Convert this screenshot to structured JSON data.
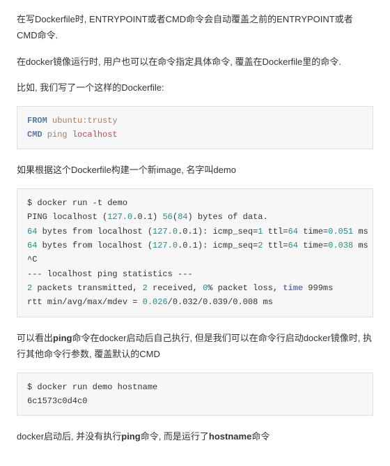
{
  "para1": "在写Dockerfile时, ENTRYPOINT或者CMD命令会自动覆盖之前的ENTRYPOINT或者CMD命令.",
  "para2": "在docker镜像运行时, 用户也可以在命令指定具体命令, 覆盖在Dockerfile里的命令.",
  "para3": "比如, 我们写了一个这样的Dockerfile:",
  "code1": {
    "from_kw": "FROM",
    "from_val": " ubuntu:trusty",
    "cmd_kw": "CMD",
    "cmd_cmd": " ping",
    "cmd_arg": " localhost"
  },
  "para4": "如果根据这个Dockerfile构建一个新image, 名字叫demo",
  "code2": {
    "line1_a": "$ docker run -t demo",
    "line2_a": "PING localhost (",
    "line2_ip": "127.0",
    "line2_b": ".0.1) ",
    "line2_n1": "56",
    "line2_c": "(",
    "line2_n2": "84",
    "line2_d": ") bytes of data.",
    "line3_n1": "64",
    "line3_a": " bytes from localhost (",
    "line3_ip": "127.0",
    "line3_b": ".0.1): icmp_seq=",
    "line3_n2": "1",
    "line3_c": " ttl=",
    "line3_n3": "64",
    "line3_d": " time=",
    "line3_n4": "0.051",
    "line3_e": " ms",
    "line4_n1": "64",
    "line4_a": " bytes from localhost (",
    "line4_ip": "127.0",
    "line4_b": ".0.1): icmp_seq=",
    "line4_n2": "2",
    "line4_c": " ttl=",
    "line4_n3": "64",
    "line4_d": " time=",
    "line4_n4": "0.038",
    "line4_e": " ms",
    "line5": "^C",
    "line6": "--- localhost ping statistics ---",
    "line7_n1": "2",
    "line7_a": " packets transmitted, ",
    "line7_n2": "2",
    "line7_b": " received, ",
    "line7_n3": "0",
    "line7_c": "% packet loss, ",
    "line7_tk": "time",
    "line7_d": " 999ms",
    "line8_a": "rtt min/avg/max/mdev = ",
    "line8_n": "0.026",
    "line8_b": "/0.032/0.039/0.008 ms"
  },
  "para5_a": "可以看出",
  "para5_b": "ping",
  "para5_c": "命令在docker启动后自己执行, 但是我们可以在命令行启动docker镜像时, 执行其他命令行参数, 覆盖默认的CMD",
  "code3": {
    "line1": "$ docker run demo hostname",
    "line2": "6c1573c0d4c0"
  },
  "para6_a": "docker启动后, 并没有执行",
  "para6_b": "ping",
  "para6_c": "命令, 而是运行了",
  "para6_d": "hostname",
  "para6_e": "命令"
}
